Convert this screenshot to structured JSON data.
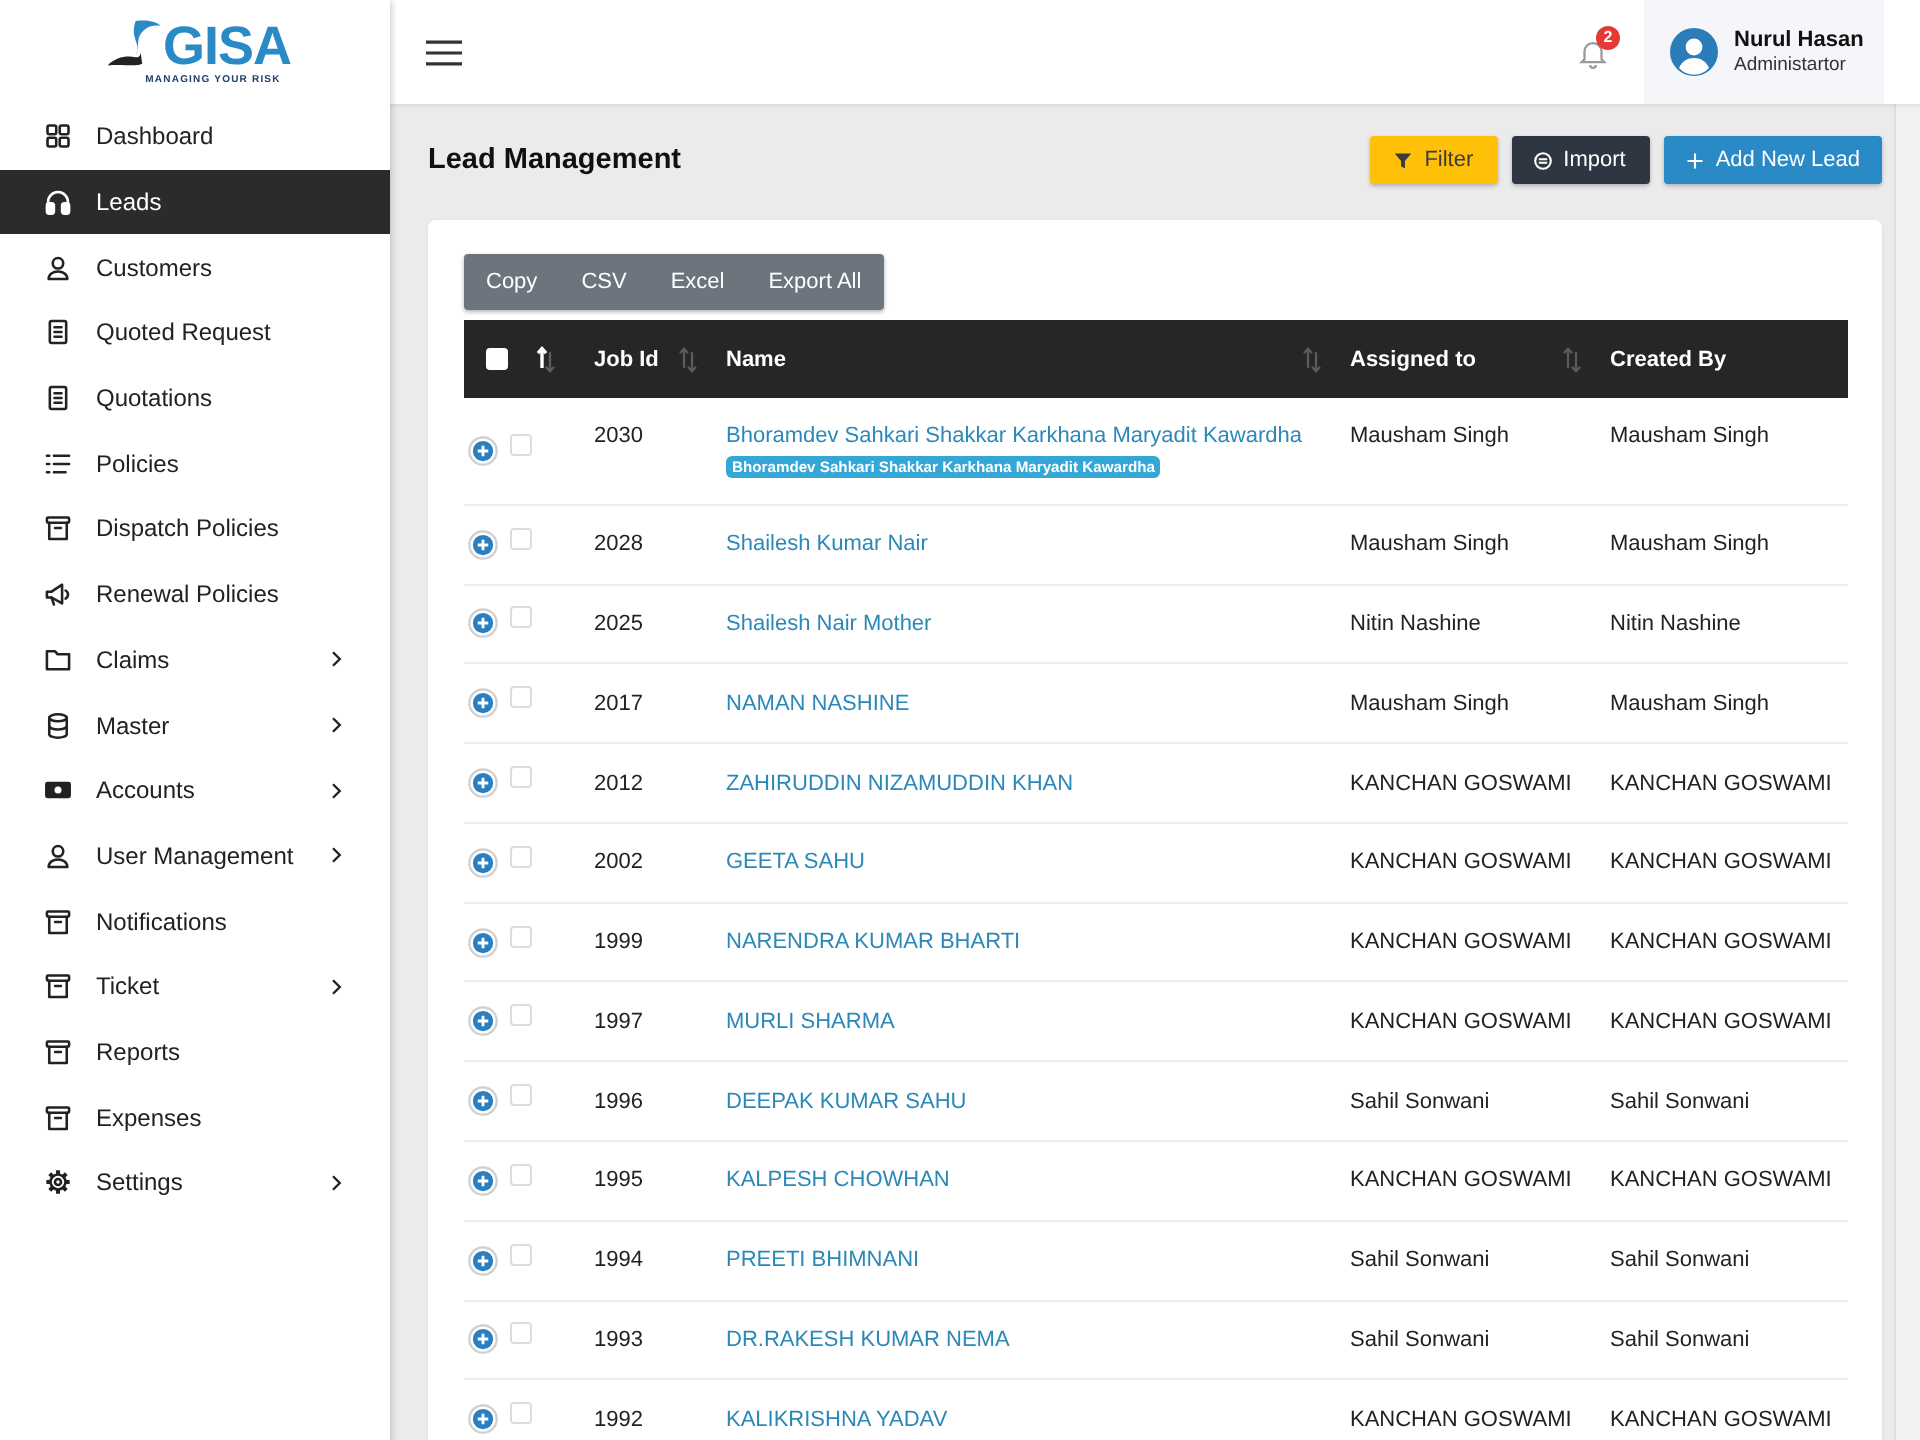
{
  "logo": {
    "brand": "GISA",
    "tagline": "MANAGING YOUR RISK"
  },
  "sidebar": {
    "items": [
      {
        "label": "Dashboard",
        "selected": false,
        "submenu": false
      },
      {
        "label": "Leads",
        "selected": true,
        "submenu": false
      },
      {
        "label": "Customers",
        "selected": false,
        "submenu": false
      },
      {
        "label": "Quoted Request",
        "selected": false,
        "submenu": false
      },
      {
        "label": "Quotations",
        "selected": false,
        "submenu": false
      },
      {
        "label": "Policies",
        "selected": false,
        "submenu": false
      },
      {
        "label": "Dispatch Policies",
        "selected": false,
        "submenu": false
      },
      {
        "label": "Renewal Policies",
        "selected": false,
        "submenu": false
      },
      {
        "label": "Claims",
        "selected": false,
        "submenu": true
      },
      {
        "label": "Master",
        "selected": false,
        "submenu": true
      },
      {
        "label": "Accounts",
        "selected": false,
        "submenu": true
      },
      {
        "label": "User Management",
        "selected": false,
        "submenu": true
      },
      {
        "label": "Notifications",
        "selected": false,
        "submenu": false
      },
      {
        "label": "Ticket",
        "selected": false,
        "submenu": true
      },
      {
        "label": "Reports",
        "selected": false,
        "submenu": false
      },
      {
        "label": "Expenses",
        "selected": false,
        "submenu": false
      },
      {
        "label": "Settings",
        "selected": false,
        "submenu": true
      }
    ]
  },
  "header": {
    "notification_count": "2",
    "user": {
      "name": "Nurul Hasan",
      "role": "Administartor"
    }
  },
  "page": {
    "title": "Lead Management",
    "actions": [
      {
        "label": "Filter",
        "kind": "filter"
      },
      {
        "label": "Import",
        "kind": "import"
      },
      {
        "label": "Add New Lead",
        "kind": "add"
      }
    ]
  },
  "table": {
    "export_buttons": [
      "Copy",
      "CSV",
      "Excel",
      "Export All"
    ],
    "columns": [
      {
        "kind": "select",
        "checked": false,
        "sortable": true,
        "sort_active": true
      },
      {
        "kind": "text",
        "label": "Job Id",
        "sortable": true,
        "sort_active": false
      },
      {
        "kind": "text",
        "label": "Name",
        "sortable": true,
        "sort_active": false
      },
      {
        "kind": "text",
        "label": "Assigned to",
        "sortable": true,
        "sort_active": false
      },
      {
        "kind": "text",
        "label": "Created By",
        "sortable": false,
        "sort_active": false
      }
    ],
    "rows": [
      {
        "expanded": false,
        "selected": false,
        "job_id": "2030",
        "name": "Bhoramdev Sahkari Shakkar Karkhana Maryadit Kawardha",
        "tag": "Bhoramdev Sahkari Shakkar Karkhana Maryadit Kawardha",
        "assigned_to": "Mausham Singh",
        "created_by": "Mausham Singh"
      },
      {
        "expanded": false,
        "selected": false,
        "job_id": "2028",
        "name": "Shailesh Kumar Nair",
        "assigned_to": "Mausham Singh",
        "created_by": "Mausham Singh"
      },
      {
        "expanded": false,
        "selected": false,
        "job_id": "2025",
        "name": "Shailesh Nair Mother",
        "assigned_to": "Nitin Nashine",
        "created_by": "Nitin Nashine"
      },
      {
        "expanded": false,
        "selected": false,
        "job_id": "2017",
        "name": "NAMAN NASHINE",
        "assigned_to": "Mausham Singh",
        "created_by": "Mausham Singh"
      },
      {
        "expanded": false,
        "selected": false,
        "job_id": "2012",
        "name": "ZAHIRUDDIN NIZAMUDDIN KHAN",
        "assigned_to": "KANCHAN GOSWAMI",
        "created_by": "KANCHAN GOSWAMI"
      },
      {
        "expanded": false,
        "selected": false,
        "job_id": "2002",
        "name": "GEETA SAHU",
        "assigned_to": "KANCHAN GOSWAMI",
        "created_by": "KANCHAN GOSWAMI"
      },
      {
        "expanded": false,
        "selected": false,
        "job_id": "1999",
        "name": "NARENDRA KUMAR BHARTI",
        "assigned_to": "KANCHAN GOSWAMI",
        "created_by": "KANCHAN GOSWAMI"
      },
      {
        "expanded": false,
        "selected": false,
        "job_id": "1997",
        "name": "MURLI SHARMA",
        "assigned_to": "KANCHAN GOSWAMI",
        "created_by": "KANCHAN GOSWAMI"
      },
      {
        "expanded": false,
        "selected": false,
        "job_id": "1996",
        "name": "DEEPAK KUMAR SAHU",
        "assigned_to": "Sahil Sonwani",
        "created_by": "Sahil Sonwani"
      },
      {
        "expanded": false,
        "selected": false,
        "job_id": "1995",
        "name": "KALPESH CHOWHAN",
        "assigned_to": "KANCHAN GOSWAMI",
        "created_by": "KANCHAN GOSWAMI"
      },
      {
        "expanded": false,
        "selected": false,
        "job_id": "1994",
        "name": "PREETI BHIMNANI",
        "assigned_to": "Sahil Sonwani",
        "created_by": "Sahil Sonwani"
      },
      {
        "expanded": false,
        "selected": false,
        "job_id": "1993",
        "name": "DR.RAKESH KUMAR NEMA",
        "assigned_to": "Sahil Sonwani",
        "created_by": "Sahil Sonwani"
      },
      {
        "expanded": false,
        "selected": false,
        "job_id": "1992",
        "name": "KALIKRISHNA YADAV",
        "assigned_to": "KANCHAN GOSWAMI",
        "created_by": "KANCHAN GOSWAMI"
      }
    ]
  }
}
